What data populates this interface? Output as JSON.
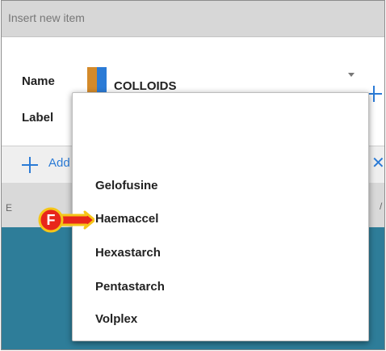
{
  "dialog": {
    "title": "Insert new item",
    "name_label": "Name",
    "label_label": "Label",
    "name_value": "COLLOIDS"
  },
  "toolbar": {
    "add_label": "Add",
    "close_glyph": "✕"
  },
  "header": {
    "left_text": "E",
    "right_text": "/"
  },
  "dropdown": {
    "items": [
      "Gelofusine",
      "Haemaccel",
      "Hexastarch",
      "Pentastarch",
      "Volplex"
    ]
  },
  "marker": {
    "letter": "F"
  },
  "colors": {
    "accent": "#2b7bd6",
    "swatch_orange": "#d48a2a",
    "swatch_blue": "#2b7bd6",
    "table_bg": "#2e7d99",
    "marker_fill": "#e8261b",
    "marker_outline": "#f5c518"
  }
}
